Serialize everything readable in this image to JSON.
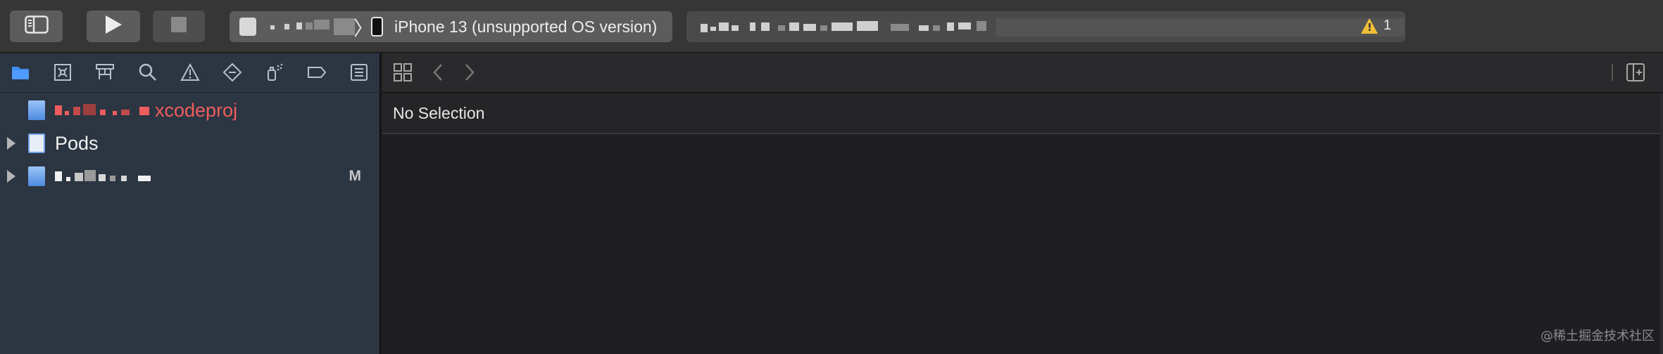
{
  "toolbar": {
    "buttons": {
      "sidebar_toggle": "sidebar-toggle-icon",
      "run": "play-icon",
      "stop": "stop-icon"
    },
    "scheme": {
      "device": "iPhone 13 (unsupported OS version)"
    },
    "activity": {
      "warning_count": "1"
    }
  },
  "navigator_icons": [
    "folder-icon",
    "source-control-icon",
    "hierarchy-icon",
    "search-icon",
    "warning-icon",
    "test-icon",
    "debug-icon",
    "breakpoint-icon",
    "report-icon"
  ],
  "tree": {
    "items": [
      {
        "label": "xcodeproj",
        "color": "#ee5d5d"
      },
      {
        "label": "Pods"
      },
      {
        "label": "",
        "badge": "M"
      }
    ]
  },
  "editor": {
    "status_text": "No Selection"
  },
  "watermark": "@稀土掘金技术社区",
  "colors": {
    "toolbar_bg": "#363636",
    "sidebar_bg": "#2c3542",
    "editor_bg": "#1f1f23",
    "accent_blue": "#3d8ef0",
    "warning_yellow": "#f2c037",
    "error_red": "#ee5d5d"
  }
}
